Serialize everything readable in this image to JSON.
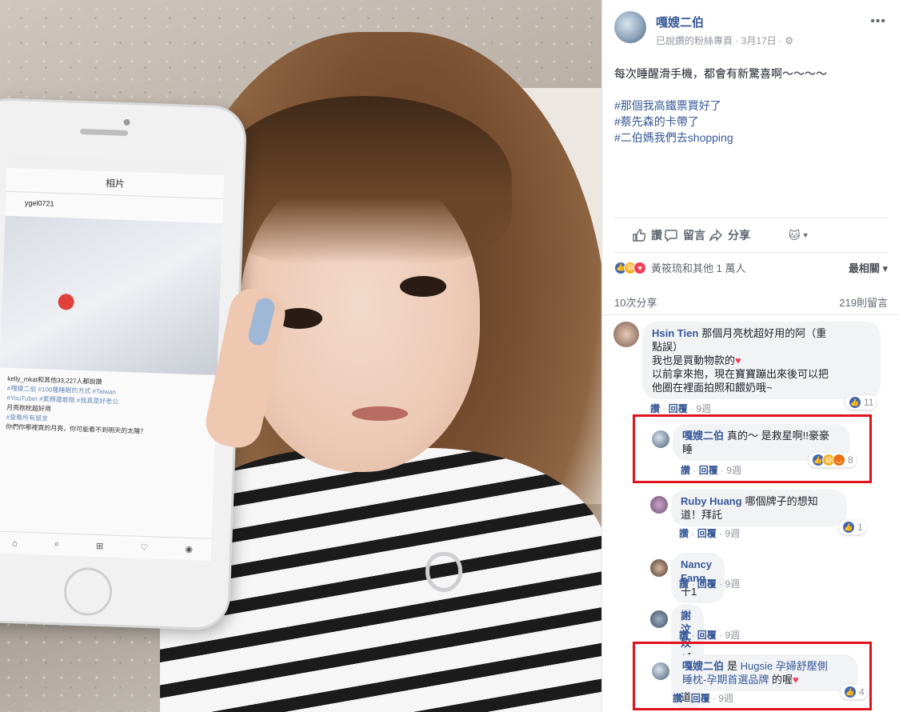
{
  "post": {
    "page_name": "嘎嫂二伯",
    "meta": "已說讚的粉絲專頁 · 3月17日 · ",
    "more_icon": "more-icon",
    "body": "每次睡醒滑手機，都會有新驚喜啊～～～～",
    "hashtags": [
      "#那個我高鐵票買好了",
      "#蔡先森的卡帶了",
      "#二伯媽我們去shopping"
    ]
  },
  "photo": {
    "nav_title": "相片",
    "account": "ygel0721",
    "caption_liker": "kelly_mkat和其他33,227人都說讚",
    "caption_lines": [
      "#嘎嫂二伯 #100種睡眠的方式 #Taiwan",
      "#YouTuber #素顏還敢剛 #我真是好老公",
      "月亮抱枕超好用",
      "#查看所有留言",
      "你們你哪裡買的月亮，你可能看不到明天的太陽？"
    ]
  },
  "actions": {
    "like": "讚",
    "comment": "留言",
    "share": "分享"
  },
  "summary": {
    "reactors": "黃筱琉和其他 1 萬人",
    "sort": "最相關 ▾",
    "shares": "10次分享",
    "comments": "219則留言"
  },
  "comments": [
    {
      "name": "Hsin Tien",
      "lines": [
        "那個月亮枕超好用的阿（重",
        "點誤）",
        "我也是買動物款的",
        "以前拿來抱，現在寶寶蹦出來後可以把",
        "他圈在裡面拍照和餵奶哦~"
      ],
      "like": "讚",
      "reply": "回覆",
      "time": "9週",
      "reactions": "11"
    },
    {
      "name": "嘎嫂二伯",
      "line1": "真的～ 是救星啊!!豪豪",
      "line2": "睡",
      "like": "讚",
      "reply": "回覆",
      "time": "9週",
      "reactions": "8"
    },
    {
      "name": "Ruby Huang",
      "line1": "哪個牌子的想知",
      "line2": "道！拜託",
      "like": "讚",
      "reply": "回覆",
      "time": "9週",
      "reactions": "1"
    },
    {
      "name": "Nancy Fang",
      "text": "十1",
      "like": "讚",
      "reply": "回覆",
      "time": "9週"
    },
    {
      "name": "謝汶姣",
      "text": "+1想知道",
      "like": "讚",
      "reply": "回覆",
      "time": "9週"
    },
    {
      "name": "嘎嫂二伯",
      "text1": "是",
      "link": "Hugsie 孕婦舒壓側",
      "link2": "睡枕-孕期首選品牌",
      "text2": " 的喔",
      "like": "讚",
      "reply": "回覆",
      "time": "9週",
      "reactions": "4"
    }
  ],
  "colors": {
    "link": "#365899",
    "highlight": "#e1141c",
    "like_blue": "#4267b2"
  }
}
